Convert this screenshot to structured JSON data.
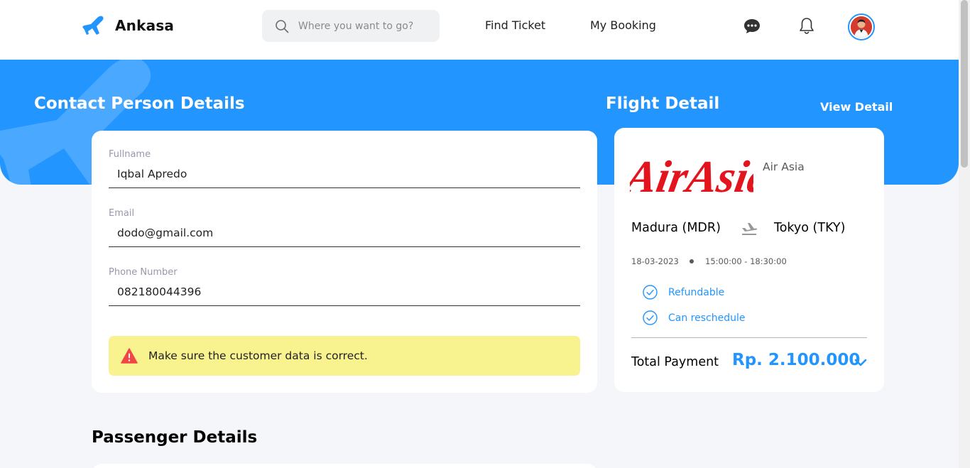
{
  "header": {
    "brand": "Ankasa",
    "search_placeholder": "Where you want to go?",
    "nav": {
      "find_ticket": "Find Ticket",
      "my_booking": "My Booking"
    }
  },
  "contact": {
    "title": "Contact Person Details",
    "fields": [
      {
        "label": "Fullname",
        "value": "Iqbal Apredo"
      },
      {
        "label": "Email",
        "value": "dodo@gmail.com"
      },
      {
        "label": "Phone Number",
        "value": "082180044396"
      }
    ],
    "warning": "Make sure the customer data is correct."
  },
  "flight": {
    "title": "Flight Detail",
    "view_detail": "View Detail",
    "airline_logo_text": "AirAsia",
    "airline_name": "Air Asia",
    "from": "Madura (MDR)",
    "to": "Tokyo (TKY)",
    "date": "18-03-2023",
    "time": "15:00:00 - 18:30:00",
    "perks": [
      "Refundable",
      "Can reschedule"
    ],
    "total_label": "Total Payment",
    "total_value": "Rp. 2.100.000"
  },
  "passenger": {
    "title": "Passenger Details"
  },
  "colors": {
    "primary": "#2395ff",
    "airasia_red": "#e4141f",
    "warning_bg": "#f9f38f",
    "warning_icon": "#f24545"
  }
}
